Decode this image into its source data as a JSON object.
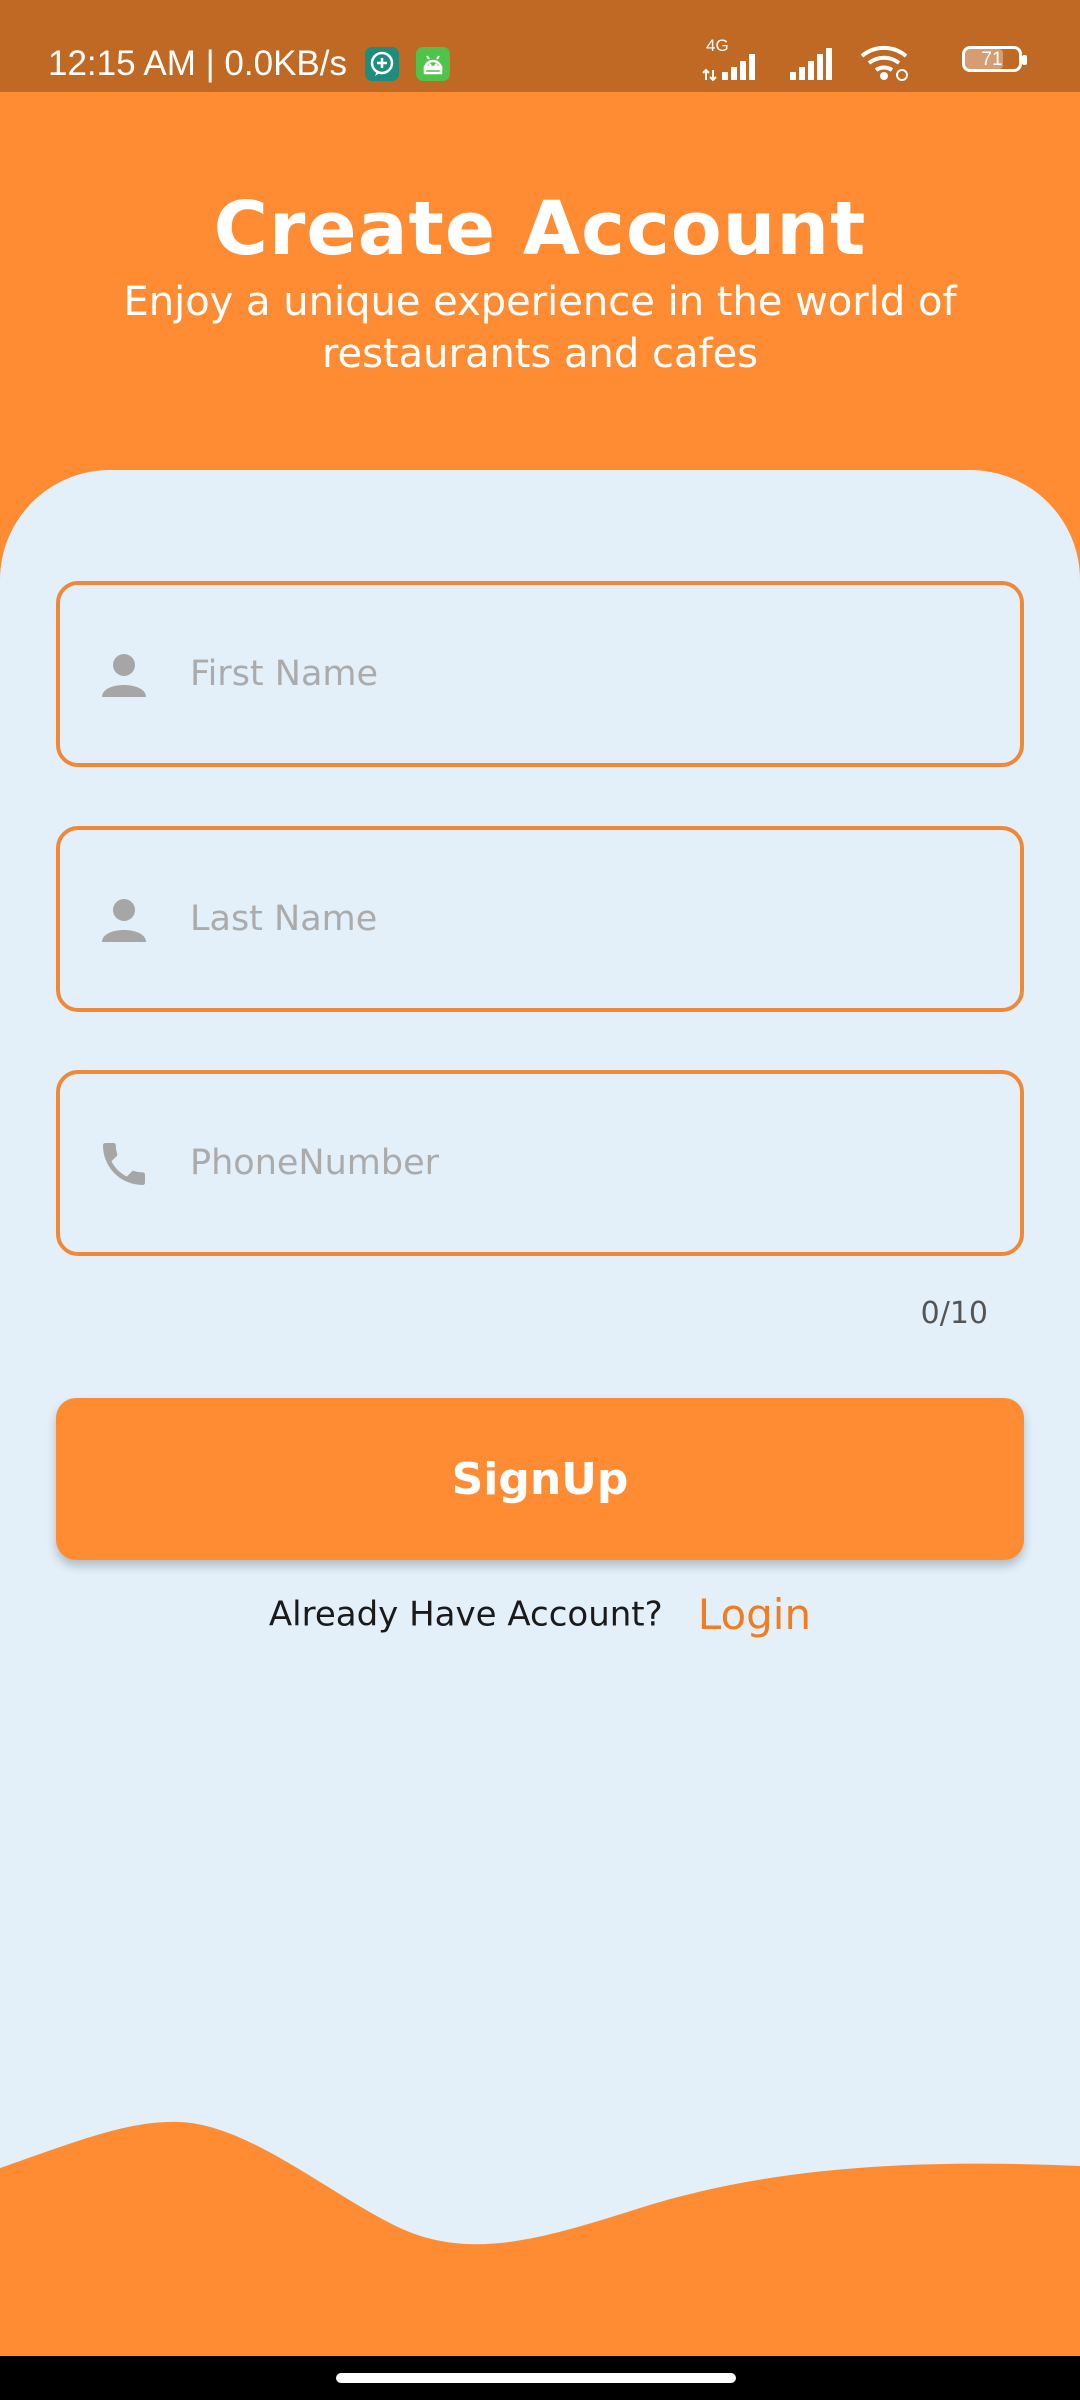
{
  "status_bar": {
    "time_speed": "12:15 AM | 0.0KB/s",
    "network_type": "4G",
    "battery_level": "71",
    "battery_fraction": 0.71,
    "icons": [
      "chat-notification-icon",
      "android-notification-icon",
      "signal-4g-icon",
      "signal-icon",
      "wifi-icon",
      "battery-icon"
    ]
  },
  "header": {
    "title": "Create Account",
    "subtitle": "Enjoy a unique experience in the world of restaurants and cafes"
  },
  "form": {
    "first_name": {
      "value": "",
      "placeholder": "First Name",
      "icon": "person-icon"
    },
    "last_name": {
      "value": "",
      "placeholder": "Last Name",
      "icon": "person-icon"
    },
    "phone": {
      "value": "",
      "placeholder": "PhoneNumber",
      "icon": "phone-icon"
    },
    "phone_counter": "0/10"
  },
  "signup_button": {
    "label": "SignUp"
  },
  "login": {
    "prompt": "Already Have Account?",
    "link_label": "Login"
  },
  "colors": {
    "accent": "#FF8C33",
    "status_bar": "#BF6925",
    "background": "#E3F0FA",
    "field_border": "#F0883A",
    "login_link": "#F07D22",
    "placeholder": "#ABABAB"
  }
}
